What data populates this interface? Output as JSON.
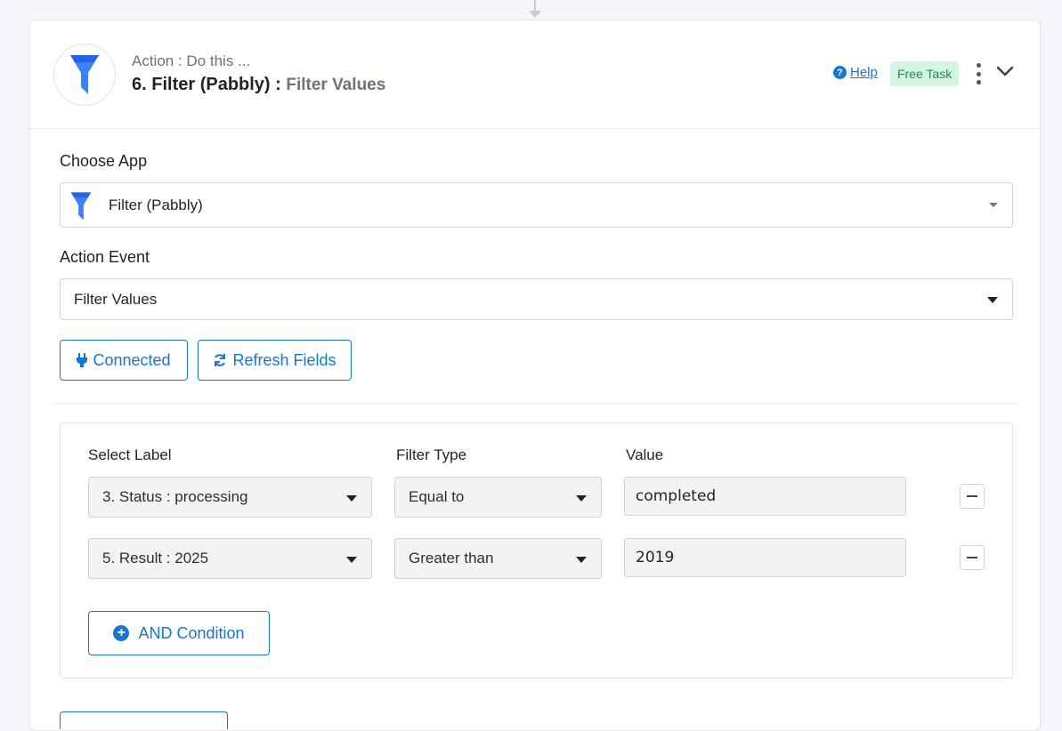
{
  "header": {
    "subtitle": "Action : Do this ...",
    "title_step": "6. Filter (Pabbly) :",
    "title_event": "Filter Values",
    "help_label": "Help",
    "badge": "Free Task",
    "logo_icon": "funnel-icon",
    "accent_color": "#1677d2"
  },
  "choose_app": {
    "label": "Choose App",
    "selected": "Filter (Pabbly)"
  },
  "action_event": {
    "label": "Action Event",
    "selected": "Filter Values"
  },
  "buttons": {
    "connected": "Connected",
    "refresh": "Refresh Fields"
  },
  "filter": {
    "col_label": "Select Label",
    "col_type": "Filter Type",
    "col_value": "Value",
    "rows": [
      {
        "label": "3. Status : processing",
        "type": "Equal to",
        "value": "completed"
      },
      {
        "label": "5. Result : 2025",
        "type": "Greater than",
        "value": "2019"
      }
    ],
    "and_button": "AND Condition"
  }
}
